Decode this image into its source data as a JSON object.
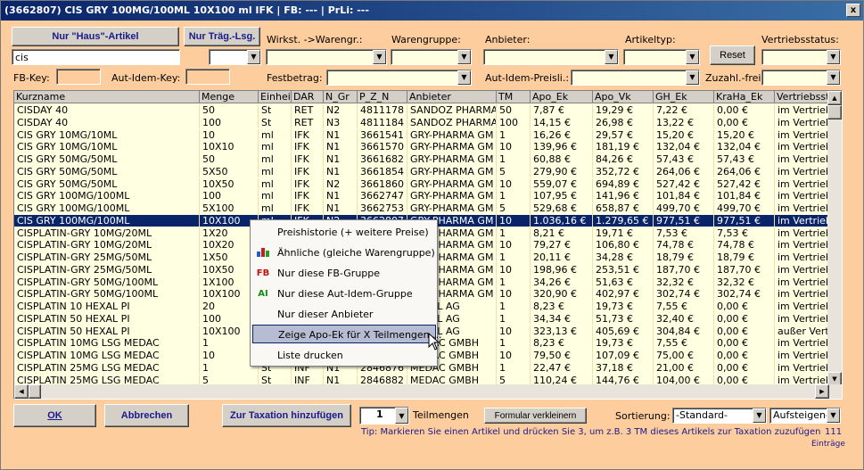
{
  "window": {
    "title": "(3662807)  CIS GRY 100MG/100ML 10X100 ml IFK   | FB: ---  | PrLi: ---",
    "close": "x"
  },
  "filters": {
    "nur_haus": "Nur \"Haus\"-Artikel",
    "nur_traeg": "Nur Träg.-Lsg.",
    "search_value": "cis",
    "wirkst_label": "Wirkst. ->Warengr.:",
    "warengruppe_label": "Warengruppe:",
    "anbieter_label": "Anbieter:",
    "artikeltyp_label": "Artikeltyp:",
    "reset": "Reset",
    "vertriebsstatus_label": "Vertriebsstatus:",
    "fbkey_label": "FB-Key:",
    "autidem_label": "Aut-Idem-Key:",
    "festbetrag_label": "Festbetrag:",
    "autidem_preisli_label": "Aut-Idem-Preisli.:",
    "zuzahl_label": "Zuzahl.-frei:"
  },
  "table": {
    "columns": [
      "Kurzname",
      "Menge",
      "Einheit",
      "DAR",
      "N_Gr",
      "P_Z_N",
      "Anbieter",
      "TM",
      "Apo_Ek",
      "Apo_Vk",
      "GH_Ek",
      "KraHa_Ek",
      "Vertriebssta"
    ],
    "rows": [
      [
        "CISDAY 40",
        "50",
        "St",
        "RET",
        "N2",
        "4811178",
        "SANDOZ PHARMA",
        "50",
        "7,87 €",
        "19,29 €",
        "7,22 €",
        "0,00 €",
        "im Vertrieb"
      ],
      [
        "CISDAY 40",
        "100",
        "St",
        "RET",
        "N3",
        "4811184",
        "SANDOZ PHARMA",
        "100",
        "14,15 €",
        "26,98 €",
        "13,22 €",
        "0,00 €",
        "im Vertrieb"
      ],
      [
        "CIS GRY 10MG/10ML",
        "10",
        "ml",
        "IFK",
        "N1",
        "3661541",
        "GRY-PHARMA GM",
        "1",
        "16,26 €",
        "29,57 €",
        "15,20 €",
        "15,20 €",
        "im Vertrieb"
      ],
      [
        "CIS GRY 10MG/10ML",
        "10X10",
        "ml",
        "IFK",
        "N1",
        "3661570",
        "GRY-PHARMA GM",
        "10",
        "139,96 €",
        "181,19 €",
        "132,04 €",
        "132,04 €",
        "im Vertrieb"
      ],
      [
        "CIS GRY 50MG/50ML",
        "50",
        "ml",
        "IFK",
        "N1",
        "3661682",
        "GRY-PHARMA GM",
        "1",
        "60,88 €",
        "84,26 €",
        "57,43 €",
        "57,43 €",
        "im Vertrieb"
      ],
      [
        "CIS GRY 50MG/50ML",
        "5X50",
        "ml",
        "IFK",
        "N1",
        "3661854",
        "GRY-PHARMA GM",
        "5",
        "279,90 €",
        "352,72 €",
        "264,06 €",
        "264,06 €",
        "im Vertrieb"
      ],
      [
        "CIS GRY 50MG/50ML",
        "10X50",
        "ml",
        "IFK",
        "N2",
        "3661860",
        "GRY-PHARMA GM",
        "10",
        "559,07 €",
        "694,89 €",
        "527,42 €",
        "527,42 €",
        "im Vertrieb"
      ],
      [
        "CIS GRY 100MG/100ML",
        "100",
        "ml",
        "IFK",
        "N1",
        "3662747",
        "GRY-PHARMA GM",
        "1",
        "107,95 €",
        "141,96 €",
        "101,84 €",
        "101,84 €",
        "im Vertrieb"
      ],
      [
        "CIS GRY 100MG/100ML",
        "5X100",
        "ml",
        "IFK",
        "N1",
        "3662753",
        "GRY-PHARMA GM",
        "5",
        "529,68 €",
        "658,87 €",
        "499,70 €",
        "499,70 €",
        "im Vertrieb"
      ],
      [
        "CIS GRY 100MG/100ML",
        "10X100",
        "ml",
        "IFK",
        "N2",
        "3662807",
        "GRY-PHARMA GM",
        "10",
        "1.036,16 €",
        "1.279,65 €",
        "977,51 €",
        "977,51 €",
        "im Vertrieb"
      ],
      [
        "CISPLATIN-GRY 10MG/20ML",
        "1X20",
        "",
        "",
        "",
        "",
        "GRY-PHARMA GM",
        "1",
        "8,21 €",
        "19,71 €",
        "7,53 €",
        "7,53 €",
        "im Vertrieb"
      ],
      [
        "CISPLATIN-GRY 10MG/20ML",
        "10X20",
        "",
        "",
        "",
        "",
        "GRY-PHARMA GM",
        "10",
        "79,27 €",
        "106,80 €",
        "74,78 €",
        "74,78 €",
        "im Vertrieb"
      ],
      [
        "CISPLATIN-GRY 25MG/50ML",
        "1X50",
        "",
        "",
        "",
        "",
        "GRY-PHARMA GM",
        "1",
        "20,11 €",
        "34,28 €",
        "18,79 €",
        "18,79 €",
        "im Vertrieb"
      ],
      [
        "CISPLATIN-GRY 25MG/50ML",
        "10X50",
        "",
        "",
        "",
        "",
        "GRY-PHARMA GM",
        "10",
        "198,96 €",
        "253,51 €",
        "187,70 €",
        "187,70 €",
        "im Vertrieb"
      ],
      [
        "CISPLATIN-GRY 50MG/100ML",
        "1X100",
        "",
        "",
        "",
        "",
        "GRY-PHARMA GM",
        "1",
        "34,26 €",
        "51,63 €",
        "32,32 €",
        "32,32 €",
        "im Vertrieb"
      ],
      [
        "CISPLATIN-GRY 50MG/100ML",
        "10X100",
        "",
        "",
        "",
        "",
        "GRY-PHARMA GM",
        "10",
        "320,90 €",
        "402,97 €",
        "302,74 €",
        "302,74 €",
        "im Vertrieb"
      ],
      [
        "CISPLATIN 10 HEXAL PI",
        "20",
        "",
        "",
        "",
        "",
        "HEXAL AG",
        "1",
        "8,23 €",
        "19,73 €",
        "7,55 €",
        "0,00 €",
        "im Vertrieb"
      ],
      [
        "CISPLATIN 50 HEXAL PI",
        "100",
        "",
        "",
        "",
        "",
        "HEXAL AG",
        "1",
        "34,34 €",
        "51,73 €",
        "32,40 €",
        "0,00 €",
        "im Vertrieb"
      ],
      [
        "CISPLATIN 50 HEXAL PI",
        "10X100",
        "",
        "",
        "",
        "",
        "HEXAL AG",
        "10",
        "323,13 €",
        "405,69 €",
        "304,84 €",
        "0,00 €",
        "außer Vertrie"
      ],
      [
        "CISPLATIN 10MG LSG MEDAC",
        "1",
        "",
        "",
        "",
        "",
        "MEDAC GMBH",
        "1",
        "8,23 €",
        "19,73 €",
        "7,55 €",
        "0,00 €",
        "im Vertrieb"
      ],
      [
        "CISPLATIN 10MG LSG MEDAC",
        "10",
        "",
        "",
        "",
        "",
        "MEDAC GMBH",
        "10",
        "79,50 €",
        "107,09 €",
        "75,00 €",
        "0,00 €",
        "im Vertrieb"
      ],
      [
        "CISPLATIN 25MG LSG MEDAC",
        "1",
        "St",
        "INF",
        "N1",
        "2846876",
        "MEDAC GMBH",
        "1",
        "22,47 €",
        "37,18 €",
        "21,00 €",
        "0,00 €",
        "im Vertrieb"
      ],
      [
        "CISPLATIN 25MG LSG MEDAC",
        "5",
        "St",
        "INF",
        "N1",
        "2846882",
        "MEDAC GMBH",
        "5",
        "110,24 €",
        "144,76 €",
        "104,00 €",
        "0,00 €",
        "im Vertrieb"
      ]
    ]
  },
  "context_menu": {
    "items": [
      {
        "label": "Preishistorie (+ weitere Preise)",
        "icon": ""
      },
      {
        "label": "Ähnliche (gleiche Warengruppe)",
        "icon": "similar-icon"
      },
      {
        "label": "Nur diese FB-Gruppe",
        "icon": "FB"
      },
      {
        "label": "Nur diese Aut-Idem-Gruppe",
        "icon": "AI"
      },
      {
        "label": "Nur dieser Anbieter",
        "icon": ""
      },
      {
        "label": "Zeige Apo-Ek für X Teilmengen....",
        "icon": ""
      },
      {
        "label": "Liste drucken",
        "icon": ""
      }
    ]
  },
  "footer": {
    "ok": "OK",
    "abbrechen": "Abbrechen",
    "zur_taxation": "Zur Taxation hinzufügen",
    "teilmengen_value": "1",
    "teilmengen_label": "Teilmengen",
    "formular": "Formular verkleinern",
    "sortierung_label": "Sortierung:",
    "sortierung_value": "-Standard-",
    "order_value": "Aufsteigend",
    "tip": "Tip: Markieren Sie einen Artikel und drücken Sie 3, um z.B. 3 TM dieses Artikels zur Taxation zuzufügen",
    "count": "111",
    "eintraege": "Einträge"
  }
}
